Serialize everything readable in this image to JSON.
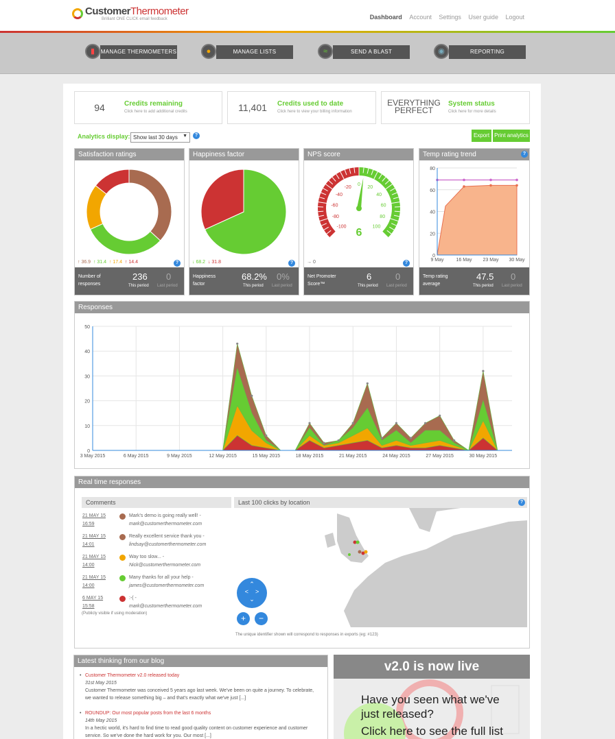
{
  "header": {
    "brand_main": "Customer",
    "brand_accent": "Thermometer",
    "tagline": "Brilliant ONE CLICK email feedback",
    "nav": [
      "Dashboard",
      "Account",
      "Settings",
      "User guide",
      "Logout"
    ]
  },
  "toolbar": [
    {
      "label": "MANAGE THERMOMETERS",
      "icon": "thermometer-icon",
      "color": "#cc3333"
    },
    {
      "label": "MANAGE LISTS",
      "icon": "user-icon",
      "color": "#f2a600"
    },
    {
      "label": "SEND A BLAST",
      "icon": "wifi-icon",
      "color": "#66cc33"
    },
    {
      "label": "REPORTING",
      "icon": "eye-icon",
      "color": "#3388dd"
    }
  ],
  "stats": [
    {
      "num": "94",
      "label": "Credits remaining",
      "sub": "Click here to add additional credits"
    },
    {
      "num": "11,401",
      "label": "Credits used to date",
      "sub": "Click here to view your billing information"
    },
    {
      "num": "EVERYTHING PERFECT",
      "label": "System status",
      "sub": "Click here for more details"
    }
  ],
  "analytics": {
    "label": "Analytics display:",
    "select": "Show last 30 days",
    "export": "Export",
    "print": "Print analytics"
  },
  "panels": [
    {
      "title": "Satisfaction ratings",
      "row": [
        "↑ 36.9",
        "↑ 31.4",
        "↑ 17.4",
        "↑ 14.4"
      ],
      "foot_label": "Number of responses",
      "value": "236",
      "last": "0",
      "period": "This period",
      "last_label": "Last period"
    },
    {
      "title": "Happiness factor",
      "row": [
        "↓ 68.2",
        "↓ 31.8"
      ],
      "foot_label": "Happiness factor",
      "value": "68.2%",
      "last": "0%",
      "period": "This period",
      "last_label": "Last period"
    },
    {
      "title": "NPS score",
      "row": [
        "→ 0"
      ],
      "foot_label": "Net Promoter Score™",
      "value": "6",
      "last": "0",
      "period": "This period",
      "last_label": "Last period",
      "gauge_value": "6",
      "gauge_labels": [
        "-100",
        "-80",
        "-60",
        "-40",
        "-20",
        "0",
        "20",
        "40",
        "60",
        "80",
        "100"
      ]
    },
    {
      "title": "Temp rating trend",
      "foot_label": "Temp rating average",
      "value": "47.5",
      "last": "0",
      "period": "This period",
      "last_label": "Last period",
      "y_ticks": [
        "0",
        "20",
        "40",
        "60",
        "80"
      ],
      "x_ticks": [
        "9 May",
        "16 May",
        "23 May",
        "30 May"
      ]
    }
  ],
  "responses": {
    "title": "Responses",
    "y_ticks": [
      "0",
      "10",
      "20",
      "30",
      "40",
      "50"
    ],
    "x_ticks": [
      "3 May 2015",
      "6 May 2015",
      "9 May 2015",
      "12 May 2015",
      "15 May 2015",
      "18 May 2015",
      "21 May 2015",
      "24 May 2015",
      "27 May 2015",
      "30 May 2015"
    ]
  },
  "realtime": {
    "title": "Real time responses",
    "comments_title": "Comments",
    "map_title": "Last 100 clicks by location",
    "moderation": "(Publicly visible if using moderation)",
    "note": "The unique identifier shown will correspond to responses in exports (eg: #123)",
    "comments": [
      {
        "date": "21 MAY 15",
        "time": "16:59",
        "color": "#a86b50",
        "text": "Mark's demo is going really well! -",
        "email": "mark@customerthermometer.com"
      },
      {
        "date": "21 MAY 15",
        "time": "14:01",
        "color": "#a86b50",
        "text": "Really excellent service thank you -",
        "email": "lindsay@customerthermometer.com"
      },
      {
        "date": "21 MAY 15",
        "time": "14:00",
        "color": "#f2a600",
        "text": "Way too slow... -",
        "email": "Nick@customerthermometer.com"
      },
      {
        "date": "21 MAY 15",
        "time": "14:00",
        "color": "#66cc33",
        "text": "Many thanks for all your help -",
        "email": "james@customerthermometer.com"
      },
      {
        "date": "6 MAY 15",
        "time": "15:58",
        "color": "#cc3333",
        "text": ":-( -",
        "email": "mark@customerthermometer.com"
      }
    ]
  },
  "blog": {
    "title": "Latest thinking from our blog",
    "items": [
      {
        "title": "Customer Thermometer v2.0 released today",
        "date": "31st May 2015",
        "text": "Customer Thermometer was conceived 5 years ago last week. We've been on quite a journey. To celebrate, we wanted to release something big – and that's exactly what we've just [...]"
      },
      {
        "title": "ROUNDUP: Our most popular posts from the last 6 months",
        "date": "14th May 2015",
        "text": "In a hectic world, it's hard to find time to read good quality content on customer experience and customer service. So we've done the hard work for you. Our most [...]"
      }
    ]
  },
  "promo": {
    "title": "v2.0 is now live",
    "text": "Have you seen what we've just released?",
    "more": "Click here to see the full list"
  },
  "chart_data": [
    {
      "type": "pie",
      "title": "Satisfaction ratings",
      "labels": [
        "Brown",
        "Green",
        "Orange",
        "Red"
      ],
      "values": [
        36.9,
        31.4,
        17.4,
        14.4
      ],
      "colors": [
        "#a86b50",
        "#66cc33",
        "#f2a600",
        "#cc3333"
      ]
    },
    {
      "type": "pie",
      "title": "Happiness factor",
      "labels": [
        "Happy",
        "Unhappy"
      ],
      "values": [
        68.2,
        31.8
      ],
      "colors": [
        "#66cc33",
        "#cc3333"
      ]
    },
    {
      "type": "area",
      "title": "Temp rating trend",
      "x": [
        "9 May",
        "12 May",
        "16 May",
        "23 May",
        "30 May"
      ],
      "series": [
        {
          "values": [
            0,
            45,
            63,
            64,
            64
          ]
        }
      ],
      "ylim": [
        0,
        80
      ]
    },
    {
      "type": "area",
      "title": "Responses",
      "x": [
        "3 May",
        "4 May",
        "5 May",
        "6 May",
        "7 May",
        "8 May",
        "9 May",
        "10 May",
        "11 May",
        "12 May",
        "13 May",
        "14 May",
        "15 May",
        "16 May",
        "17 May",
        "18 May",
        "19 May",
        "20 May",
        "21 May",
        "22 May",
        "23 May",
        "24 May",
        "25 May",
        "26 May",
        "27 May",
        "28 May",
        "29 May",
        "30 May",
        "31 May",
        "1 Jun"
      ],
      "ylim": [
        0,
        50
      ],
      "series": [
        {
          "color": "#cc3333",
          "values": [
            0,
            0,
            0,
            0,
            0,
            0,
            0,
            0,
            0,
            0,
            6,
            2,
            1,
            0,
            0,
            4,
            1,
            2,
            3,
            4,
            1,
            2,
            1,
            1,
            2,
            1,
            0,
            5,
            0,
            0
          ]
        },
        {
          "color": "#f2a600",
          "values": [
            0,
            0,
            0,
            0,
            0,
            0,
            0,
            0,
            0,
            0,
            12,
            6,
            2,
            0,
            0,
            2,
            1,
            1,
            3,
            5,
            1,
            2,
            1,
            2,
            2,
            1,
            0,
            7,
            0,
            0
          ]
        },
        {
          "color": "#66cc33",
          "values": [
            0,
            0,
            0,
            0,
            0,
            0,
            0,
            0,
            0,
            0,
            15,
            7,
            1,
            0,
            0,
            3,
            0,
            1,
            3,
            8,
            2,
            4,
            1,
            5,
            4,
            1,
            0,
            8,
            0,
            0
          ]
        },
        {
          "color": "#a86b50",
          "values": [
            0,
            0,
            0,
            0,
            0,
            0,
            0,
            0,
            0,
            0,
            10,
            7,
            2,
            0,
            0,
            2,
            1,
            0,
            2,
            10,
            1,
            3,
            2,
            3,
            6,
            1,
            0,
            12,
            0,
            0
          ]
        }
      ]
    }
  ]
}
